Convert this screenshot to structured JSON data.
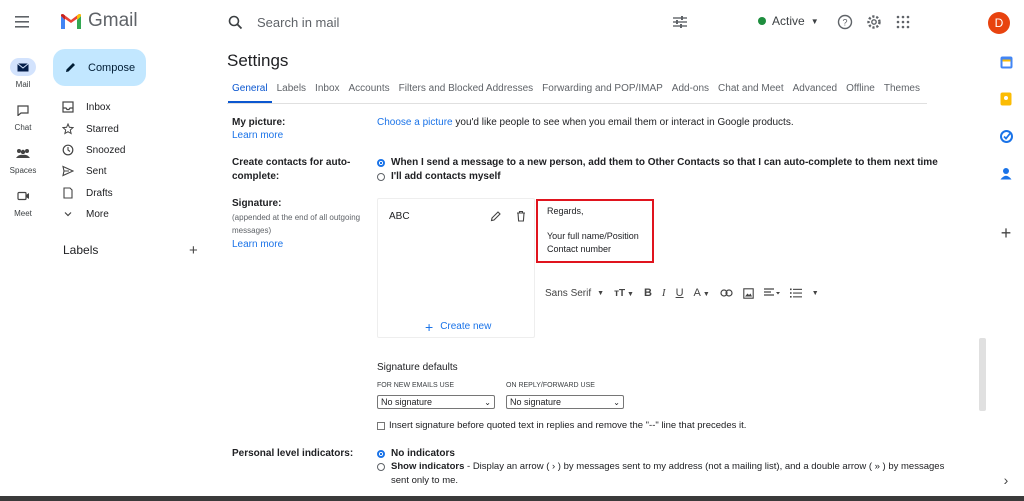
{
  "app": {
    "name": "Gmail"
  },
  "search": {
    "placeholder": "Search in mail"
  },
  "status": {
    "label": "Active"
  },
  "user": {
    "initial": "D"
  },
  "rail": [
    {
      "label": "Mail"
    },
    {
      "label": "Chat"
    },
    {
      "label": "Spaces"
    },
    {
      "label": "Meet"
    }
  ],
  "compose": {
    "label": "Compose"
  },
  "nav": [
    {
      "label": "Inbox"
    },
    {
      "label": "Starred"
    },
    {
      "label": "Snoozed"
    },
    {
      "label": "Sent"
    },
    {
      "label": "Drafts"
    },
    {
      "label": "More"
    }
  ],
  "labels_section": {
    "title": "Labels"
  },
  "settings": {
    "title": "Settings",
    "tabs": [
      {
        "label": "General"
      },
      {
        "label": "Labels"
      },
      {
        "label": "Inbox"
      },
      {
        "label": "Accounts"
      },
      {
        "label": "Filters and Blocked Addresses"
      },
      {
        "label": "Forwarding and POP/IMAP"
      },
      {
        "label": "Add-ons"
      },
      {
        "label": "Chat and Meet"
      },
      {
        "label": "Advanced"
      },
      {
        "label": "Offline"
      },
      {
        "label": "Themes"
      }
    ],
    "picture": {
      "label": "My picture:",
      "learn_more": "Learn more",
      "choose_link": "Choose a picture",
      "choose_rest": " you'd like people to see when you email them or interact in Google products."
    },
    "contacts": {
      "label_line1": "Create contacts for auto-",
      "label_line2": "complete:",
      "option1": "When I send a message to a new person, add them to Other Contacts so that I can auto-complete to them next time",
      "option2": "I'll add contacts myself"
    },
    "signature": {
      "label": "Signature:",
      "note_line1": "(appended at the end of all outgoing",
      "note_line2": "messages)",
      "learn_more": "Learn more",
      "name": "ABC",
      "body_line1": "Regards,",
      "body_line2": "Your full name/Position",
      "body_line3": "Contact number",
      "font": "Sans Serif",
      "create_new": "Create new",
      "defaults_title": "Signature defaults",
      "new_emails_label": "FOR NEW EMAILS USE",
      "reply_label": "ON REPLY/FORWARD USE",
      "new_emails_value": "No signature",
      "reply_value": "No signature",
      "insert_text": "Insert signature before quoted text in replies and remove the \"--\" line that precedes it."
    },
    "personal": {
      "label": "Personal level indicators:",
      "option1": "No indicators",
      "option2_bold": "Show indicators",
      "option2_rest": " - Display an arrow ( › ) by messages sent to my address (not a mailing list), and a double arrow ( » ) by messages",
      "option2_line2": "sent only to me."
    }
  },
  "colors": {
    "accent": "#0b57d0",
    "compose_bg": "#c2e7ff",
    "highlight_box": "#e0141e",
    "avatar": "#e8430f"
  }
}
